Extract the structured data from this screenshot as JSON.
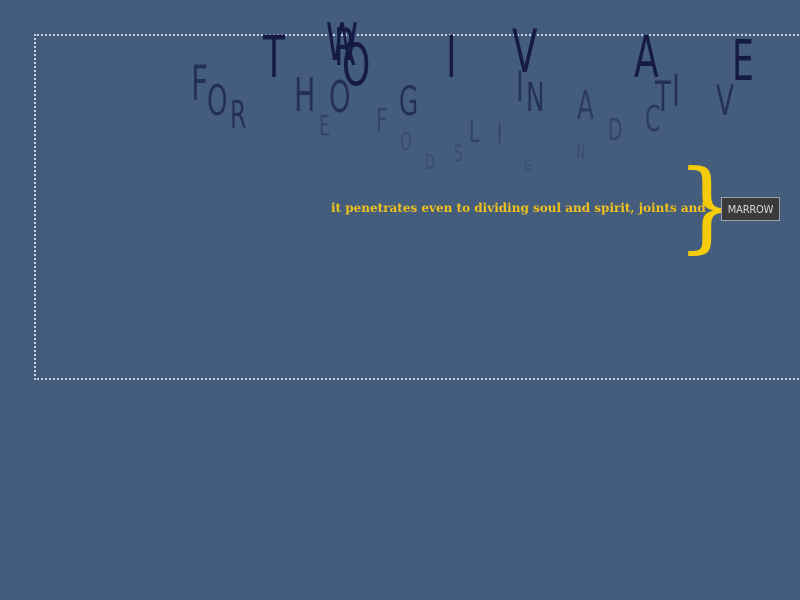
{
  "colors": {
    "background": "#445d7d",
    "frame": "#c9d2de",
    "verse": "#f2c21a",
    "brace": "#f5cc0a",
    "button_bg": "#3a3a3a",
    "button_text": "#d9d9d9"
  },
  "scattered_letters": [
    {
      "char": "T",
      "color": "#151b45"
    },
    {
      "char": "W",
      "color": "#151b45"
    },
    {
      "char": "R",
      "color": "#151b45"
    },
    {
      "char": "I",
      "color": "#151b45"
    },
    {
      "char": "V",
      "color": "#151b45"
    },
    {
      "char": "A",
      "color": "#151b45"
    },
    {
      "char": "E",
      "color": "#151b45"
    },
    {
      "char": "F",
      "color": "#25305a"
    },
    {
      "char": "O",
      "color": "#25305a"
    },
    {
      "char": "R",
      "color": "#25305a"
    },
    {
      "char": "H",
      "color": "#25305a"
    },
    {
      "char": "O",
      "color": "#25305a"
    },
    {
      "char": "O",
      "color": "#151b45"
    },
    {
      "char": "G",
      "color": "#25305a"
    },
    {
      "char": "I",
      "color": "#25305a"
    },
    {
      "char": "N",
      "color": "#25305a"
    },
    {
      "char": "A",
      "color": "#2d3a62"
    },
    {
      "char": "T",
      "color": "#25305a"
    },
    {
      "char": "I",
      "color": "#25305a"
    },
    {
      "char": "V",
      "color": "#25305a"
    },
    {
      "char": "C",
      "color": "#2d3a62"
    },
    {
      "char": "E",
      "color": "#34416a"
    },
    {
      "char": "F",
      "color": "#34416a"
    },
    {
      "char": "L",
      "color": "#34416a"
    },
    {
      "char": "I",
      "color": "#34416a"
    },
    {
      "char": "D",
      "color": "#34416a"
    },
    {
      "char": "O",
      "color": "#3a4a73"
    },
    {
      "char": "S",
      "color": "#3a4a73"
    },
    {
      "char": "D",
      "color": "#3a4a73"
    },
    {
      "char": "N",
      "color": "#3a4a73"
    },
    {
      "char": "G",
      "color": "#3a4a73"
    }
  ],
  "verse": "it penetrates even to dividing soul and spirit, joints and",
  "brace": "}",
  "button_label": "MARROW"
}
